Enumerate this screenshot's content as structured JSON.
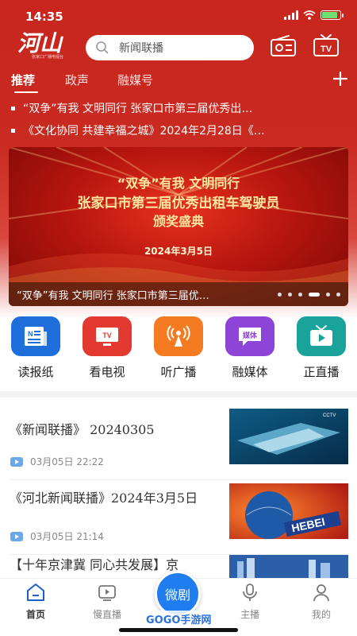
{
  "status_bar": {
    "time": "14:35"
  },
  "header": {
    "logo_text": "河山",
    "logo_sub": "张家口广播电视台",
    "search_placeholder": "新闻联播"
  },
  "nav": {
    "tabs": [
      {
        "label": "推荐",
        "active": true
      },
      {
        "label": "政声"
      },
      {
        "label": "融媒号"
      }
    ]
  },
  "ticker": [
    "“双争”有我 文明同行 张家口市第三届优秀出…",
    "《文化协同 共建幸福之城》2024年2月28日《…"
  ],
  "banner": {
    "line1": "“双争”有我  文明同行",
    "line2": "张家口市第三届优秀出租车驾驶员",
    "line3": "颁奖盛典",
    "date": "2024年3月5日",
    "caption": "“双争”有我 文明同行 张家口市第三届优…",
    "slide_count": 6,
    "active_slide": 4
  },
  "shortcuts": [
    {
      "label": "读报纸",
      "icon": "newspaper-icon",
      "color": "#1e6fd9"
    },
    {
      "label": "看电视",
      "icon": "tv-icon",
      "color": "#e23a31"
    },
    {
      "label": "听广播",
      "icon": "broadcast-icon",
      "color": "#f57b22"
    },
    {
      "label": "融媒体",
      "icon": "media-chat-icon",
      "color": "#8c45d6"
    },
    {
      "label": "正直播",
      "icon": "live-tv-icon",
      "color": "#1aa39a"
    }
  ],
  "news": [
    {
      "title": "《新闻联播》 20240305",
      "time": "03月05日 22:22"
    },
    {
      "title": "《河北新闻联播》2024年3月5日",
      "time": "03月05日 21:14"
    },
    {
      "title": "【十年京津冀 同心共发展】京",
      "time": ""
    }
  ],
  "tab_bar": {
    "items": [
      {
        "label": "首页",
        "active": true
      },
      {
        "label": "慢直播"
      },
      {
        "label": "微剧"
      },
      {
        "label": "主播"
      },
      {
        "label": "我的"
      }
    ],
    "watermark": "GOGO手游网"
  },
  "colors": {
    "brand_red": "#c8261d",
    "accent_blue": "#1f7df0"
  }
}
